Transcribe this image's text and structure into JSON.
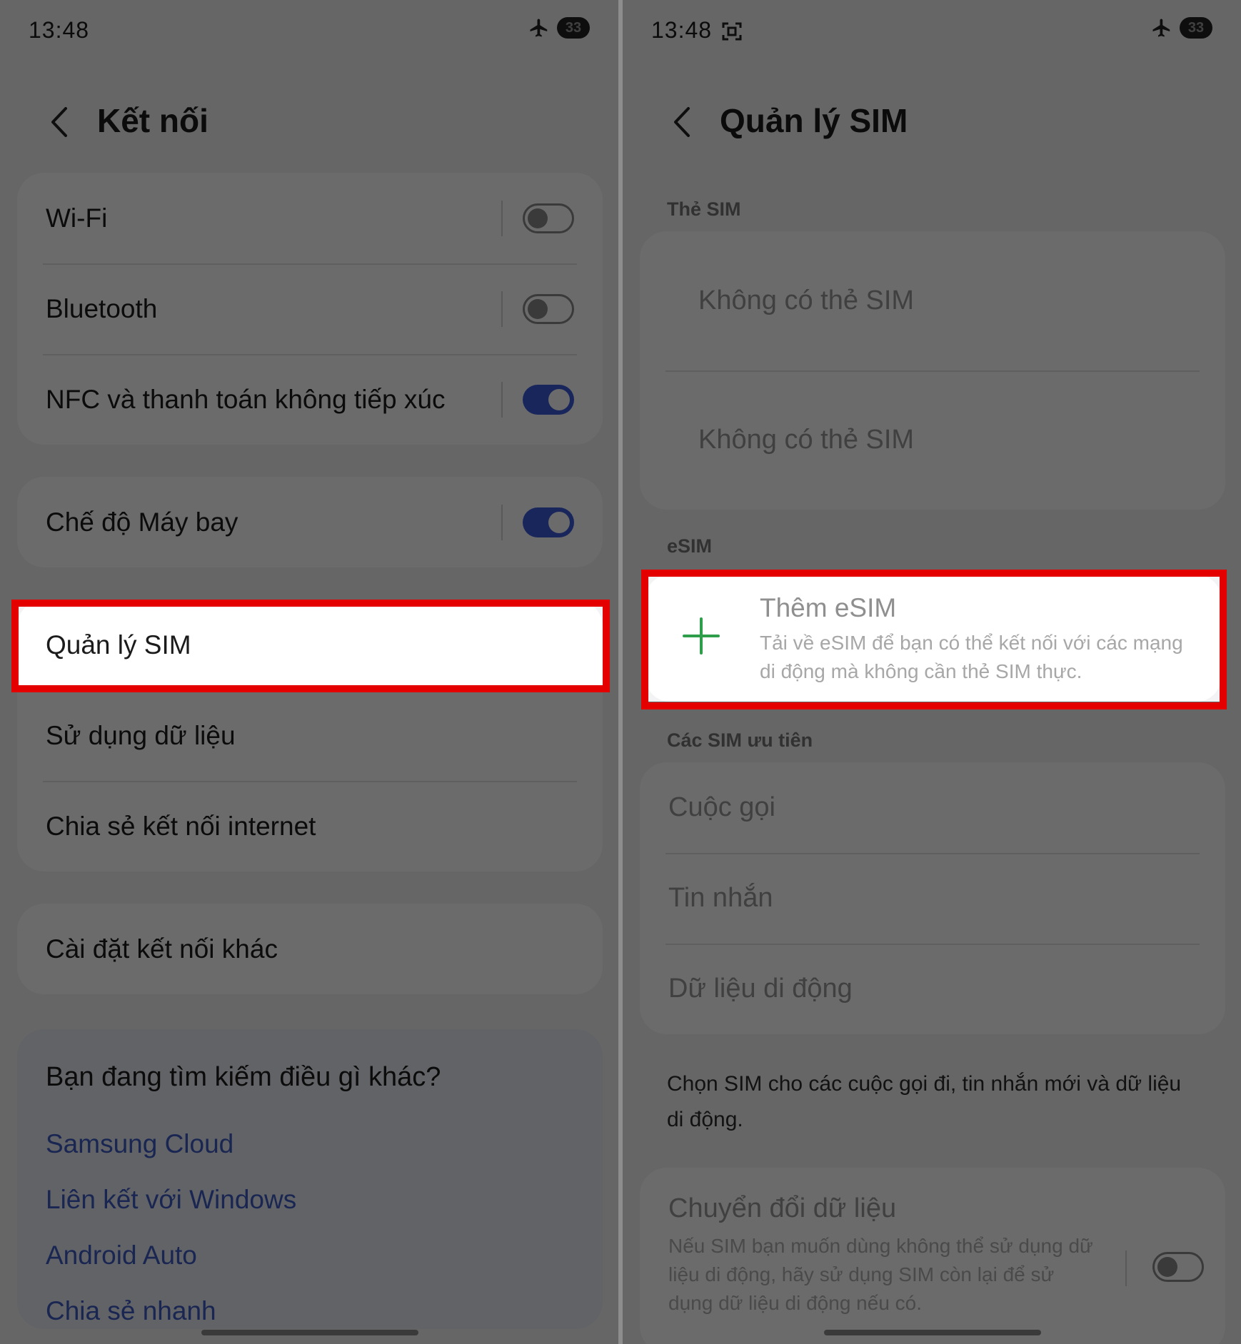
{
  "left": {
    "status": {
      "time": "13:48",
      "battery": "33"
    },
    "title": "Kết nối",
    "group1": [
      {
        "label": "Wi-Fi",
        "toggle": "off"
      },
      {
        "label": "Bluetooth",
        "toggle": "off"
      },
      {
        "label": "NFC và thanh toán không tiếp xúc",
        "toggle": "on"
      }
    ],
    "airplane": {
      "label": "Chế độ Máy bay",
      "toggle": "on"
    },
    "group3": [
      "Quản lý SIM",
      "Sử dụng dữ liệu",
      "Chia sẻ kết nối internet"
    ],
    "more_settings": "Cài đặt kết nối khác",
    "search": {
      "title": "Bạn đang tìm kiếm điều gì khác?",
      "links": [
        "Samsung Cloud",
        "Liên kết với Windows",
        "Android Auto",
        "Chia sẻ nhanh"
      ]
    }
  },
  "right": {
    "status": {
      "time": "13:48",
      "battery": "33"
    },
    "title": "Quản lý SIM",
    "sim_section": "Thẻ SIM",
    "sim_cards": [
      "Không có thẻ SIM",
      "Không có thẻ SIM"
    ],
    "esim_section": "eSIM",
    "add_esim": {
      "title": "Thêm eSIM",
      "description": "Tải về eSIM để bạn có thể kết nối với các mạng di động mà không cần thẻ SIM thực."
    },
    "preferred_section": "Các SIM ưu tiên",
    "preferred": [
      "Cuộc gọi",
      "Tin nhắn",
      "Dữ liệu di động"
    ],
    "note": "Chọn SIM cho các cuộc gọi đi, tin nhắn mới và dữ liệu di động.",
    "data_switch": {
      "title": "Chuyển đổi dữ liệu",
      "description": "Nếu SIM bạn muốn dùng không thể sử dụng dữ liệu di động, hãy sử dụng SIM còn lại để sử dụng dữ liệu di động nếu có.",
      "toggle": "off"
    }
  },
  "colors": {
    "highlight": "#e50000",
    "toggle_on": "#3b5bdb",
    "link": "#3e5bc4",
    "plus": "#2e9e4a"
  }
}
